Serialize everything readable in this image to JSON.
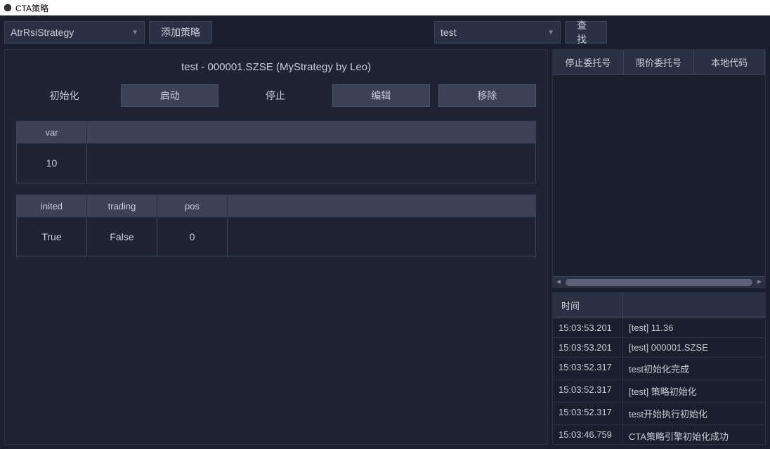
{
  "window": {
    "title": "CTA策略"
  },
  "toolbar": {
    "strategy_dropdown": "AtrRsiStrategy",
    "add_strategy_btn": "添加策略",
    "search_dropdown": "test",
    "search_btn": "查找"
  },
  "strategy": {
    "title": "test  -  000001.SZSE  (MyStrategy by Leo)",
    "actions": {
      "init": "初始化",
      "start": "启动",
      "stop": "停止",
      "edit": "编辑",
      "remove": "移除"
    },
    "vars_table": {
      "headers": [
        "var"
      ],
      "values": [
        "10"
      ]
    },
    "status_table": {
      "headers": [
        "inited",
        "trading",
        "pos"
      ],
      "values": [
        "True",
        "False",
        "0"
      ]
    }
  },
  "orders_panel": {
    "columns": [
      "停止委托号",
      "限价委托号",
      "本地代码"
    ]
  },
  "log_panel": {
    "header": "时间",
    "rows": [
      {
        "time": "15:03:53.201",
        "msg": "[test]  11.36"
      },
      {
        "time": "15:03:53.201",
        "msg": "[test]  000001.SZSE"
      },
      {
        "time": "15:03:52.317",
        "msg": "test初始化完成"
      },
      {
        "time": "15:03:52.317",
        "msg": "[test]  策略初始化"
      },
      {
        "time": "15:03:52.317",
        "msg": "test开始执行初始化"
      },
      {
        "time": "15:03:46.759",
        "msg": "CTA策略引擎初始化成功"
      }
    ]
  }
}
